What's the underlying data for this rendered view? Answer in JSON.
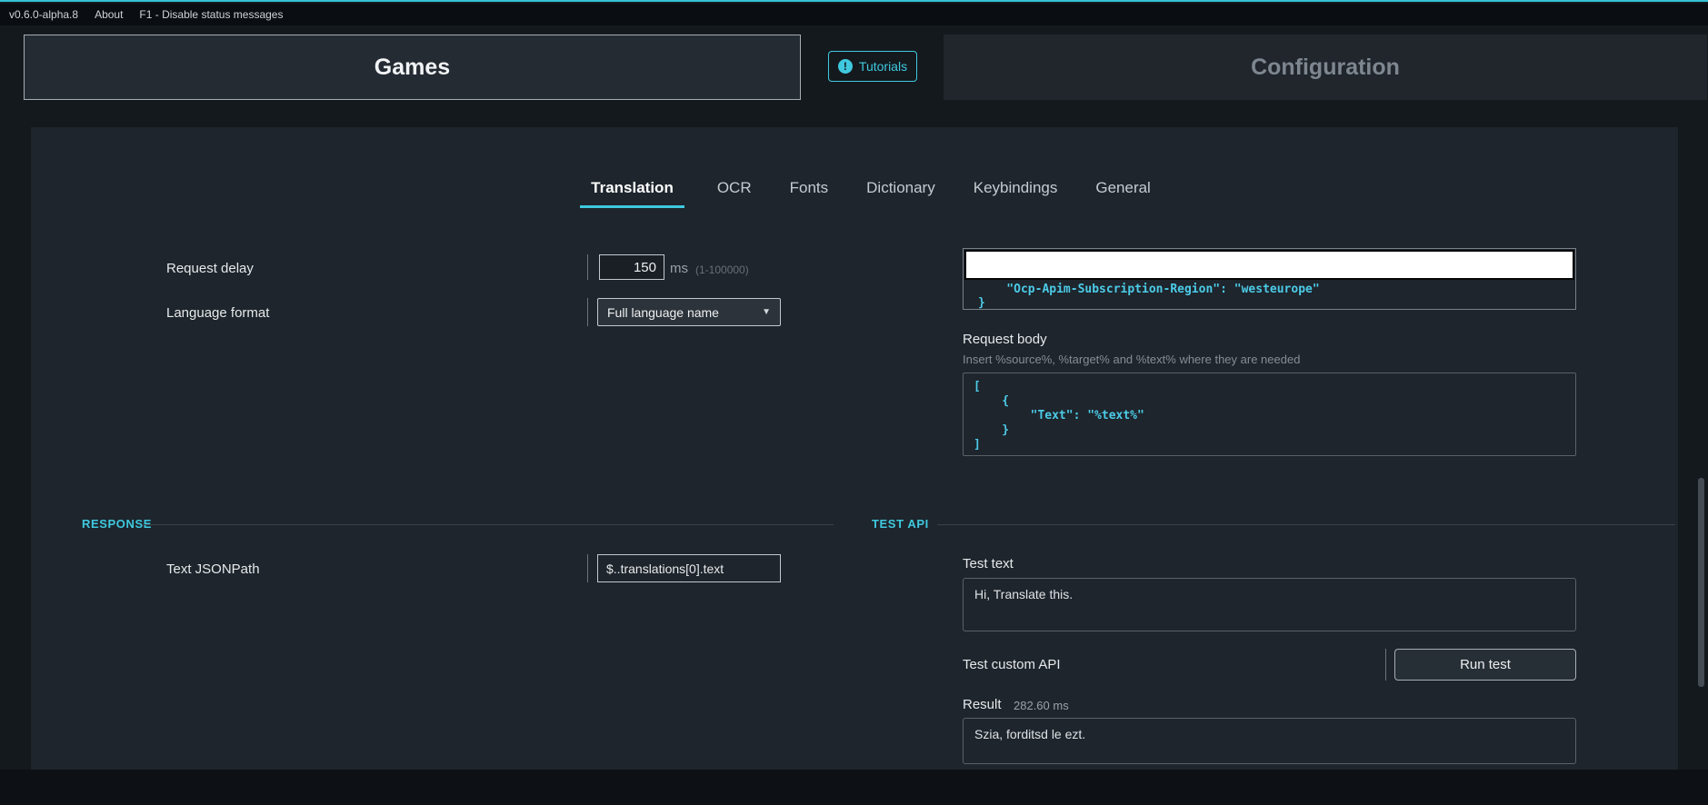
{
  "menubar": {
    "version": "v0.6.0-alpha.8",
    "about": "About",
    "hint": "F1 - Disable status messages"
  },
  "header": {
    "games": "Games",
    "tutorials": "Tutorials",
    "configuration": "Configuration"
  },
  "tabs": {
    "translation": "Translation",
    "ocr": "OCR",
    "fonts": "Fonts",
    "dictionary": "Dictionary",
    "keybindings": "Keybindings",
    "general": "General"
  },
  "translation": {
    "request_delay": {
      "label": "Request delay",
      "value": "150",
      "unit": "ms",
      "range": "(1-100000)"
    },
    "language_format": {
      "label": "Language format",
      "value": "Full language name"
    },
    "request_headers": {
      "line_region": "    \"Ocp-Apim-Subscription-Region\": \"westeurope\"",
      "line_close": "}"
    },
    "request_body": {
      "label": "Request body",
      "hint": "Insert %source%, %target% and %text% where they are needed",
      "code": {
        "l1": "[",
        "l2": "    {",
        "l3": "        \"Text\": \"%text%\"",
        "l4": "    }",
        "l5": "]"
      }
    }
  },
  "response": {
    "title": "RESPONSE",
    "jsonpath_label": "Text JSONPath",
    "jsonpath_value": "$..translations[0].text"
  },
  "test_api": {
    "title": "TEST API",
    "test_text_label": "Test text",
    "test_text_value": "Hi, Translate this.",
    "test_custom_label": "Test custom API",
    "run_button": "Run test",
    "result_label": "Result",
    "result_time": "282.60 ms",
    "result_value": "Szia, forditsd le ezt."
  },
  "icons": {
    "tutorials_info": "!",
    "dropdown_arrow": "▼"
  },
  "colors": {
    "accent": "#3fc9df",
    "code": "#4ccbe8",
    "panel": "#1e252c",
    "background": "#14191e"
  }
}
